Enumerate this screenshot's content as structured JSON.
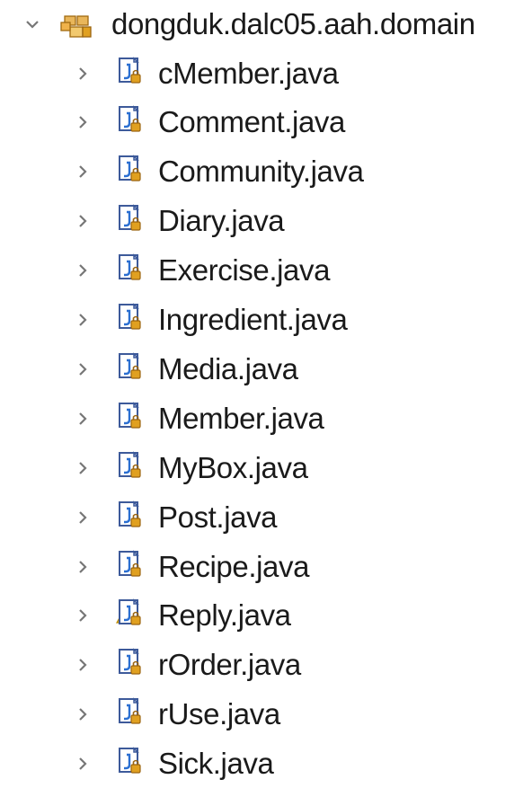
{
  "package": {
    "name": "dongduk.dalc05.aah.domain",
    "expanded": true,
    "icon": "package-icon"
  },
  "files": [
    {
      "name": "cMember.java",
      "icon": "java-file-icon",
      "warning": false
    },
    {
      "name": "Comment.java",
      "icon": "java-file-icon",
      "warning": false
    },
    {
      "name": "Community.java",
      "icon": "java-file-icon",
      "warning": false
    },
    {
      "name": "Diary.java",
      "icon": "java-file-icon",
      "warning": false
    },
    {
      "name": "Exercise.java",
      "icon": "java-file-icon",
      "warning": false
    },
    {
      "name": "Ingredient.java",
      "icon": "java-file-icon",
      "warning": false
    },
    {
      "name": "Media.java",
      "icon": "java-file-icon",
      "warning": false
    },
    {
      "name": "Member.java",
      "icon": "java-file-icon",
      "warning": false
    },
    {
      "name": "MyBox.java",
      "icon": "java-file-icon",
      "warning": false
    },
    {
      "name": "Post.java",
      "icon": "java-file-icon",
      "warning": false
    },
    {
      "name": "Recipe.java",
      "icon": "java-file-icon",
      "warning": false
    },
    {
      "name": "Reply.java",
      "icon": "java-file-warning-icon",
      "warning": true
    },
    {
      "name": "rOrder.java",
      "icon": "java-file-icon",
      "warning": false
    },
    {
      "name": "rUse.java",
      "icon": "java-file-icon",
      "warning": false
    },
    {
      "name": "Sick.java",
      "icon": "java-file-icon",
      "warning": false
    }
  ],
  "colors": {
    "lock": "#e0a020",
    "file_outline": "#3d5a9a",
    "warning": "#f2c22e",
    "twisty": "#777777"
  }
}
